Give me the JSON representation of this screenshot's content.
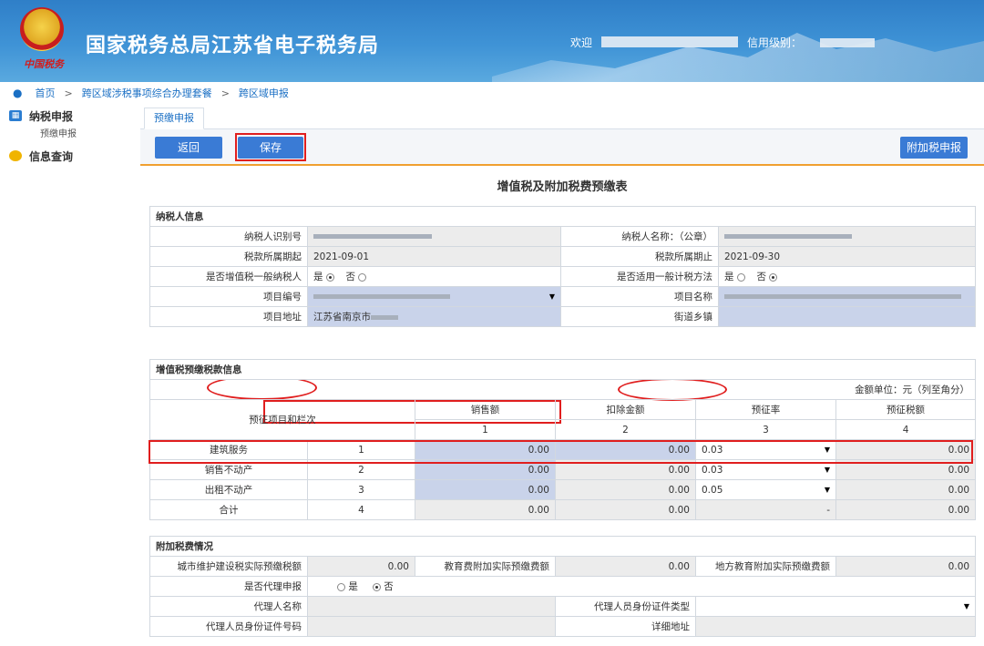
{
  "header": {
    "title": "国家税务总局江苏省电子税务局",
    "emblem_text": "中国税务",
    "welcome": "欢迎",
    "credit": "信用级别："
  },
  "breadcrumb": [
    "首页",
    "跨区域涉税事项综合办理套餐",
    "跨区域申报"
  ],
  "sidebar": {
    "groups": [
      {
        "label": "纳税申报",
        "items": [
          "预缴申报"
        ]
      },
      {
        "label": "信息查询",
        "items": []
      }
    ]
  },
  "tab": "预缴申报",
  "toolbar": {
    "back": "返回",
    "save": "保存",
    "attach": "附加税申报"
  },
  "form_title": "增值税及附加税费预缴表",
  "taxpayer": {
    "section": "纳税人信息",
    "id_label": "纳税人识别号",
    "name_label": "纳税人名称：（公章）",
    "period_start_label": "税款所属期起",
    "period_start": "2021-09-01",
    "period_end_label": "税款所属期止",
    "period_end": "2021-09-30",
    "general_label": "是否增值税一般纳税人",
    "general_method_label": "是否适用一般计税方法",
    "yes": "是",
    "no": "否",
    "project_no_label": "项目编号",
    "project_name_label": "项目名称",
    "address_label": "项目地址",
    "address": "江苏省南京市",
    "street_label": "街道乡镇"
  },
  "vat": {
    "section": "增值税预缴税款信息",
    "unit": "金额单位：元（列至角分）",
    "col_item": "预征项目和栏次",
    "columns": [
      "销售额",
      "扣除金额",
      "预征率",
      "预征税额"
    ],
    "col_nums": [
      "1",
      "2",
      "3",
      "4"
    ],
    "rows": [
      {
        "name": "建筑服务",
        "no": "1",
        "sales": "0.00",
        "deduct": "0.00",
        "rate": "0.03",
        "tax": "0.00"
      },
      {
        "name": "销售不动产",
        "no": "2",
        "sales": "0.00",
        "deduct": "0.00",
        "rate": "0.03",
        "tax": "0.00"
      },
      {
        "name": "出租不动产",
        "no": "3",
        "sales": "0.00",
        "deduct": "0.00",
        "rate": "0.05",
        "tax": "0.00"
      },
      {
        "name": "合计",
        "no": "4",
        "sales": "0.00",
        "deduct": "0.00",
        "rate": "-",
        "tax": "0.00"
      }
    ]
  },
  "surtax": {
    "section": "附加税费情况",
    "city_label": "城市维护建设税实际预缴税额",
    "city_val": "0.00",
    "edu_label": "教育费附加实际预缴费额",
    "edu_val": "0.00",
    "local_edu_label": "地方教育附加实际预缴费额",
    "local_edu_val": "0.00",
    "agent_label": "是否代理申报",
    "agent_name_label": "代理人名称",
    "agent_id_type_label": "代理人员身份证件类型",
    "agent_id_no_label": "代理人员身份证件号码",
    "detail_addr_label": "详细地址"
  }
}
